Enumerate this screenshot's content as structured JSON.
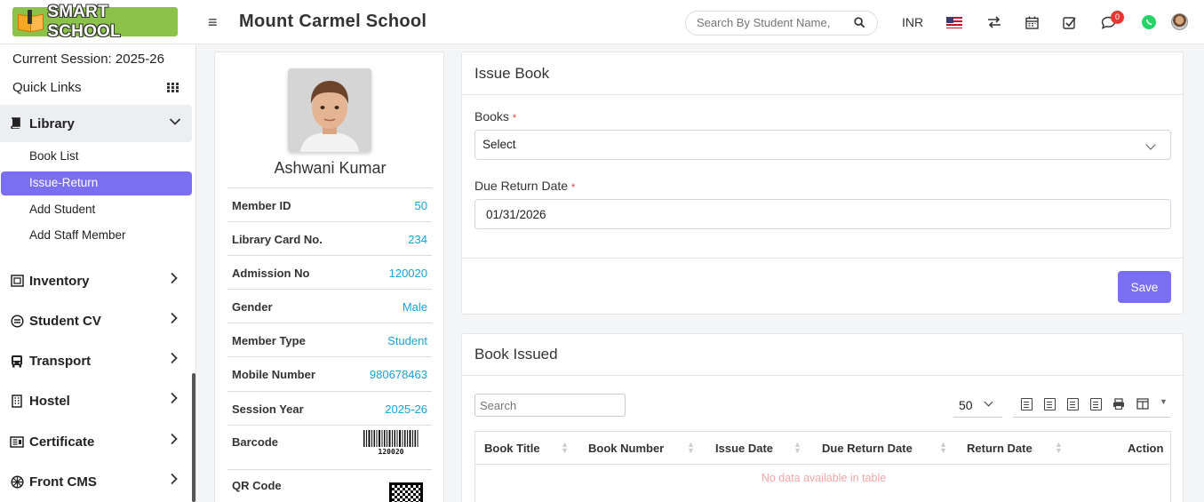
{
  "header": {
    "logo_text": "SMART SCHOOL",
    "school_name": "Mount Carmel School",
    "search_placeholder": "Search By Student Name,",
    "currency": "INR",
    "notification_count": "0"
  },
  "sidebar": {
    "session": "Current Session: 2025-26",
    "quick_links": "Quick Links",
    "active_section": "Library",
    "library_items": [
      "Book List",
      "Issue-Return",
      "Add Student",
      "Add Staff Member"
    ],
    "menus": [
      "Inventory",
      "Student CV",
      "Transport",
      "Hostel",
      "Certificate",
      "Front CMS"
    ]
  },
  "profile": {
    "name": "Ashwani Kumar",
    "fields": [
      {
        "label": "Member ID",
        "value": "50"
      },
      {
        "label": "Library Card No.",
        "value": "234"
      },
      {
        "label": "Admission No",
        "value": "120020"
      },
      {
        "label": "Gender",
        "value": "Male"
      },
      {
        "label": "Member Type",
        "value": "Student"
      },
      {
        "label": "Mobile Number",
        "value": "980678463"
      },
      {
        "label": "Session Year",
        "value": "2025-26"
      }
    ],
    "barcode_label": "Barcode",
    "barcode_value": "120020",
    "qr_label": "QR Code"
  },
  "issue_book": {
    "title": "Issue Book",
    "books_label": "Books",
    "books_value": "Select",
    "due_label": "Due Return Date",
    "due_value": "01/31/2026",
    "save_label": "Save"
  },
  "book_issued": {
    "title": "Book Issued",
    "search_placeholder": "Search",
    "per_page": "50",
    "columns": [
      "Book Title",
      "Book Number",
      "Issue Date",
      "Due Return Date",
      "Return Date",
      "Action"
    ],
    "empty_message": "No data available in table"
  },
  "colors": {
    "accent": "#7a6ff0",
    "link_value": "#17a2d8",
    "logo_bg": "#8bc34a"
  }
}
